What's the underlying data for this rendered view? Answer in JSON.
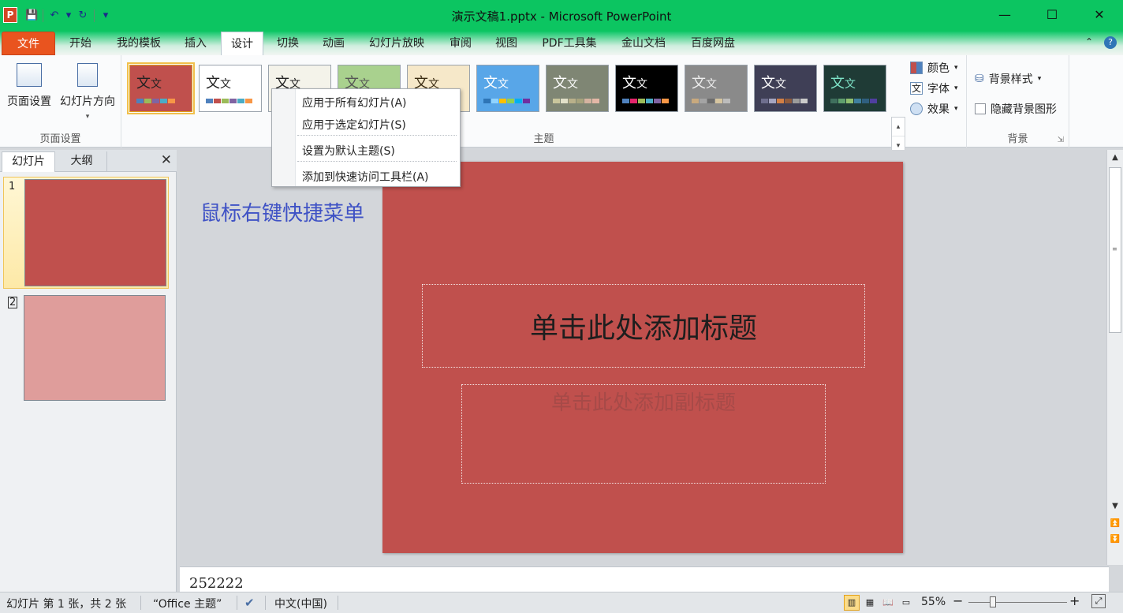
{
  "window": {
    "title": "演示文稿1.pptx - Microsoft PowerPoint",
    "app_icon_letter": "P",
    "minimize": "—",
    "maximize": "☐",
    "close": "✕"
  },
  "qat": {
    "save": "💾",
    "undo": "↶",
    "dropdown": "▾",
    "redo": "↻",
    "customize": "▾"
  },
  "tabs": [
    {
      "label": "文件"
    },
    {
      "label": "开始"
    },
    {
      "label": "我的模板"
    },
    {
      "label": "插入"
    },
    {
      "label": "设计"
    },
    {
      "label": "切换"
    },
    {
      "label": "动画"
    },
    {
      "label": "幻灯片放映"
    },
    {
      "label": "审阅"
    },
    {
      "label": "视图"
    },
    {
      "label": "PDF工具集"
    },
    {
      "label": "金山文档"
    },
    {
      "label": "百度网盘"
    }
  ],
  "active_tab": "设计",
  "ribbon": {
    "page_setup": {
      "page_setup_label": "页面设置",
      "orientation_label": "幻灯片方向",
      "orientation_arrow": "▾",
      "group_label": "页面设置"
    },
    "themes": {
      "group_label": "主题",
      "sample_text_big": "文",
      "sample_text_small": "文",
      "items": [
        {
          "bg": "#c0504d",
          "text_color": "#222",
          "colors": [
            "#4f81bd",
            "#9bbb59",
            "#8064a2",
            "#4bacc6",
            "#f79646"
          ]
        },
        {
          "bg": "#ffffff",
          "text_color": "#222",
          "colors": [
            "#4f81bd",
            "#c0504d",
            "#9bbb59",
            "#8064a2",
            "#4bacc6",
            "#f79646"
          ]
        },
        {
          "bg": "#f4f3ea",
          "text_color": "#222",
          "colors": [
            "#4f81bd",
            "#c0504d",
            "#9bbb59"
          ]
        },
        {
          "bg": "#a9d18e",
          "text_color": "#555",
          "colors": [
            "#5b9bd5",
            "#70ad47"
          ]
        },
        {
          "bg": "#f6e8c9",
          "text_color": "#3a2b12",
          "colors": [
            "#d09a4a",
            "#b06a2b"
          ]
        },
        {
          "bg": "#58a6e8",
          "text_color": "#fff",
          "colors": [
            "#2e75b6",
            "#8fd3ff",
            "#ffc000",
            "#92d050",
            "#00b0f0",
            "#7030a0"
          ]
        },
        {
          "bg": "#7f8674",
          "text_color": "#fff",
          "colors": [
            "#c9c69c",
            "#e2e0c9",
            "#b9b08a",
            "#a6a27c",
            "#d5b3a0",
            "#e3b7a6"
          ]
        },
        {
          "bg": "#000000",
          "text_color": "#fff",
          "colors": [
            "#4f81bd",
            "#e3256b",
            "#9bbb59",
            "#4bacc6",
            "#8064a2",
            "#f79646"
          ]
        },
        {
          "bg": "#8a8a8a",
          "text_color": "#eee",
          "colors": [
            "#c8a97e",
            "#a4a4a4",
            "#6d6d6d",
            "#d6c5a0",
            "#bcbcbc"
          ]
        },
        {
          "bg": "#3f3f56",
          "text_color": "#fff",
          "colors": [
            "#6f6f8e",
            "#a5a5c0",
            "#d17f45",
            "#8e5b3d",
            "#9b9b9b",
            "#cbcbcb"
          ]
        },
        {
          "bg": "#1f3b36",
          "text_color": "#7fe5c9",
          "colors": [
            "#3f6f5d",
            "#5f9f6d",
            "#8fbf6f",
            "#3f7f9f",
            "#2f5f7f",
            "#4f3f9f"
          ]
        }
      ],
      "scroll_up": "▴",
      "scroll_down": "▾",
      "more": "▾"
    },
    "variants": [
      {
        "label": "颜色",
        "arrow": "▾"
      },
      {
        "label": "字体",
        "arrow": "▾"
      },
      {
        "label": "效果",
        "arrow": "▾"
      }
    ],
    "background": {
      "group_label": "背景",
      "style_label": "背景样式",
      "style_arrow": "▾",
      "hide_label": "隐藏背景图形",
      "launcher": "⇲"
    }
  },
  "context_menu": {
    "items": [
      {
        "label": "应用于所有幻灯片(A)"
      },
      {
        "label": "应用于选定幻灯片(S)"
      },
      {
        "label": "设置为默认主题(S)"
      },
      {
        "label": "添加到快速访问工具栏(A)"
      }
    ]
  },
  "slides_pane": {
    "tabs": [
      {
        "label": "幻灯片"
      },
      {
        "label": "大纲"
      }
    ],
    "close": "✕",
    "slides": [
      {
        "number": "1",
        "color": "#c0504d"
      },
      {
        "number": "2",
        "color": "#df9d9b"
      }
    ]
  },
  "annotation": "鼠标右键快捷菜单",
  "slide": {
    "title_placeholder": "单击此处添加标题",
    "subtitle_placeholder": "单击此处添加副标题",
    "bg_color": "#c0504d"
  },
  "notes_text": "252222",
  "statusbar": {
    "slide_info": "幻灯片 第 1 张，共 2 张",
    "theme": "“Office 主题”",
    "language": "中文(中国)",
    "zoom": "55%",
    "zoom_out": "−",
    "zoom_in": "+",
    "zoom_value": 0.55
  },
  "colors": {
    "titlebar": "#0cc561",
    "file_tab": "#e9541f",
    "annotation": "#3f52c5"
  }
}
